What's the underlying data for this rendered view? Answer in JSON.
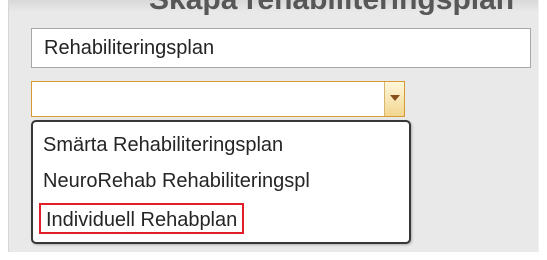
{
  "header": {
    "title_fragment": "Skapa rehabiliteringsplan"
  },
  "form": {
    "plan_name_value": "Rehabiliteringsplan",
    "plan_type_selected": ""
  },
  "dropdown": {
    "options": [
      "Smärta Rehabiliteringsplan",
      "NeuroRehab Rehabiliteringspl",
      "Individuell Rehabplan"
    ]
  },
  "colors": {
    "highlight_border": "#e01f2b",
    "dropdown_border": "#373737",
    "select_border": "#d69a36"
  }
}
